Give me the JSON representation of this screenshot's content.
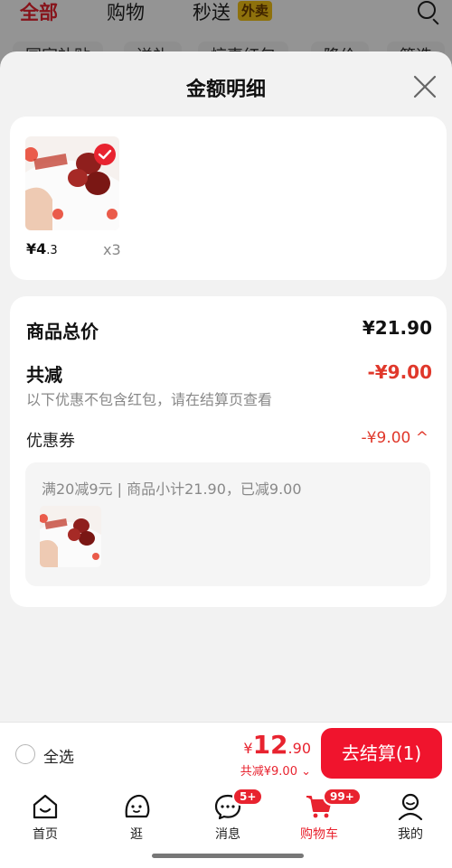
{
  "top_tabs": [
    {
      "label": "全部",
      "active": true
    },
    {
      "label": "购物",
      "active": false
    },
    {
      "label": "秒送",
      "active": false
    }
  ],
  "takeaway_badge": "外卖",
  "filter_chips": [
    "国家补贴",
    "送礼",
    "惊喜红包",
    "降价",
    "筛选"
  ],
  "sheet": {
    "title": "金额明细",
    "product": {
      "price_int": "¥4",
      "price_dec": ".3",
      "quantity": "x3"
    },
    "summary": {
      "total_label": "商品总价",
      "total_value": "¥21.90",
      "discount_label": "共减",
      "discount_value": "-¥9.00",
      "discount_note": "以下优惠不包含红包，请在结算页查看",
      "coupon_label": "优惠券",
      "coupon_value": "-¥9.00 ^",
      "coupon_desc": "满20减9元 | 商品小计21.90，已减9.00"
    }
  },
  "checkout": {
    "select_all": "全选",
    "price_currency": "¥",
    "price_int": "12",
    "price_dec": ".90",
    "discount_line": "共减¥9.00 ⌄",
    "button": "去结算(1)"
  },
  "tab_bar": [
    {
      "label": "首页",
      "icon": "home-icon"
    },
    {
      "label": "逛",
      "icon": "browse-icon"
    },
    {
      "label": "消息",
      "icon": "message-icon",
      "badge": "5+"
    },
    {
      "label": "购物车",
      "icon": "cart-icon",
      "badge": "99+",
      "active": true
    },
    {
      "label": "我的",
      "icon": "profile-icon"
    }
  ],
  "colors": {
    "accent": "#e8232f",
    "discount": "#e0382b"
  }
}
